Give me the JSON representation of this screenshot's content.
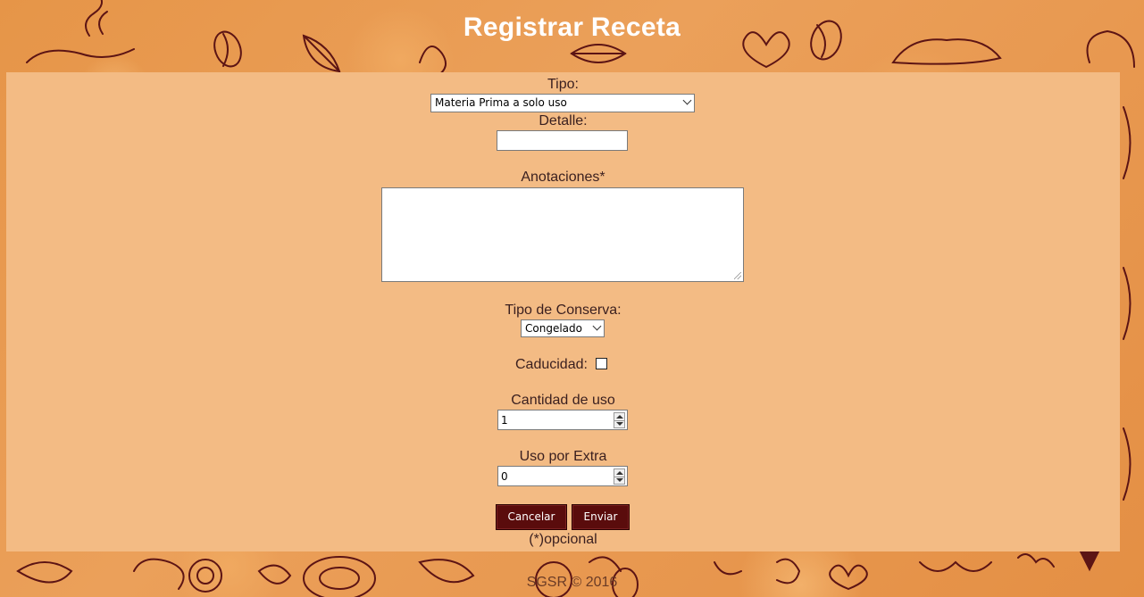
{
  "page": {
    "title": "Registrar Receta"
  },
  "form": {
    "tipo": {
      "label": "Tipo:",
      "selected": "Materia Prima a solo uso"
    },
    "detalle": {
      "label": "Detalle:",
      "value": ""
    },
    "anotaciones": {
      "label": "Anotaciones*",
      "value": ""
    },
    "tipo_conserva": {
      "label": "Tipo de Conserva:",
      "selected": "Congelado"
    },
    "caducidad": {
      "label": "Caducidad:",
      "checked": false
    },
    "cantidad_uso": {
      "label": "Cantidad de uso",
      "value": "1"
    },
    "uso_extra": {
      "label": "Uso por Extra",
      "value": "0"
    },
    "buttons": {
      "cancel": "Cancelar",
      "submit": "Enviar"
    },
    "optional_note": "(*)opcional"
  },
  "footer": {
    "text": "SGSR © 2016"
  },
  "colors": {
    "background": "#e59a4f",
    "panel": "#f3bb84",
    "button": "#5a0c0c",
    "doodle": "#5c1414"
  }
}
